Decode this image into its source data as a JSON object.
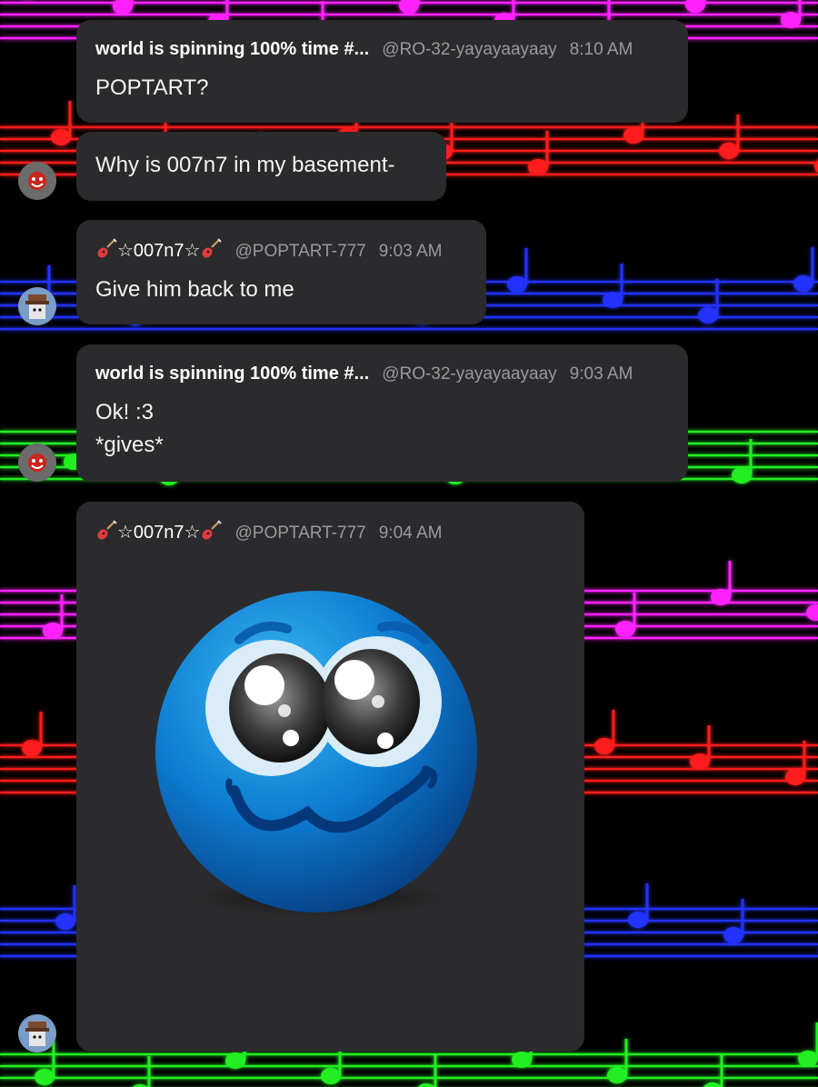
{
  "theme": {
    "bubble_bg": "#2b2b2d",
    "staff_colors": [
      "#ff22ff",
      "#ff1a1a",
      "#2233ff",
      "#22ee22"
    ]
  },
  "messages": [
    {
      "username": "world is spinning 100% time #...",
      "handle": "@RO-32-yayayaayaay",
      "time": "8:10 AM",
      "text": "POPTART?"
    },
    {
      "text": "Why is 007n7 in my basement-"
    },
    {
      "username_parts": [
        "☆007n7☆"
      ],
      "handle": "@POPTART-777",
      "time": "9:03 AM",
      "text": "Give him back to me"
    },
    {
      "username": "world is spinning 100% time #...",
      "handle": "@RO-32-yayayaayaay",
      "time": "9:03 AM",
      "text": "Ok! :3\n*gives*"
    },
    {
      "username_parts": [
        "☆007n7☆"
      ],
      "handle": "@POPTART-777",
      "time": "9:04 AM",
      "image": "blue-smiley-emoji"
    }
  ],
  "avatars": [
    {
      "name": "red-smiley-avatar"
    },
    {
      "name": "roblox-hat-avatar"
    },
    {
      "name": "red-smiley-avatar"
    },
    {
      "name": "roblox-hat-avatar"
    }
  ],
  "icons": {
    "guitar": "guitar-icon"
  }
}
